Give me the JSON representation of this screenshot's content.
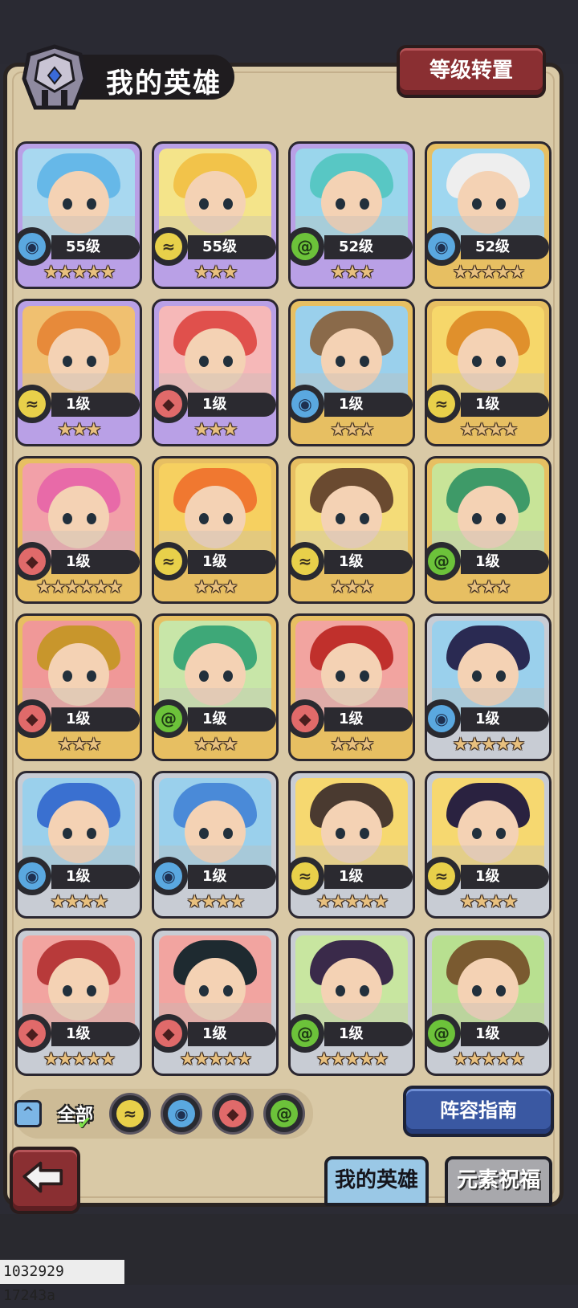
{
  "header": {
    "title": "我的英雄",
    "level_transfer_button": "等级转置"
  },
  "colors": {
    "panel_bg": "#d9c9a6",
    "card_purple": "#b9a0e6",
    "card_gold": "#e7bf62",
    "card_silver": "#c8ccd4",
    "element_water": "#5aa8e0",
    "element_earth": "#e8d04a",
    "element_wind": "#6cc23a",
    "element_fire": "#e06a6a"
  },
  "heroes": [
    {
      "level": "55级",
      "element": "water",
      "stars": "★★★★★",
      "rarity": "purple",
      "hair": "#66b8e8",
      "bg": "#a8d8f0"
    },
    {
      "level": "55级",
      "element": "earth",
      "stars": "★★★",
      "rarity": "purple",
      "hair": "#f2c34a",
      "bg": "#f4e48a"
    },
    {
      "level": "52级",
      "element": "wind",
      "stars": "★★★",
      "rarity": "purple",
      "hair": "#58c7c4",
      "bg": "#9ad6ec"
    },
    {
      "level": "52级",
      "element": "water",
      "stars": "★★★★★",
      "rarity": "gold",
      "hair": "#eeeeee",
      "bg": "#9fd7f0"
    },
    {
      "level": "1级",
      "element": "earth",
      "stars": "★★★",
      "rarity": "purple",
      "hair": "#e78a3a",
      "bg": "#f0c070"
    },
    {
      "level": "1级",
      "element": "fire",
      "stars": "★★★",
      "rarity": "purple",
      "hair": "#e0504c",
      "bg": "#f6b8b8"
    },
    {
      "level": "1级",
      "element": "water",
      "stars": "★★★",
      "rarity": "gold",
      "hair": "#8a6a4a",
      "bg": "#9ad0ec"
    },
    {
      "level": "1级",
      "element": "earth",
      "stars": "★★★★",
      "rarity": "gold",
      "hair": "#e0902c",
      "bg": "#f6d76a"
    },
    {
      "level": "1级",
      "element": "fire",
      "stars": "★★★★★★",
      "rarity": "gold",
      "hair": "#e86aa8",
      "bg": "#f2a0a8"
    },
    {
      "level": "1级",
      "element": "earth",
      "stars": "★★★",
      "rarity": "gold",
      "hair": "#f07830",
      "bg": "#f6d060"
    },
    {
      "level": "1级",
      "element": "earth",
      "stars": "★★★",
      "rarity": "gold",
      "hair": "#6a4a30",
      "bg": "#f4dc78"
    },
    {
      "level": "1级",
      "element": "wind",
      "stars": "★★★",
      "rarity": "gold",
      "hair": "#3e9a68",
      "bg": "#c8e498"
    },
    {
      "level": "1级",
      "element": "fire",
      "stars": "★★★",
      "rarity": "gold",
      "hair": "#c8962c",
      "bg": "#f09898"
    },
    {
      "level": "1级",
      "element": "wind",
      "stars": "★★★",
      "rarity": "gold",
      "hair": "#3ea878",
      "bg": "#c8e6a8"
    },
    {
      "level": "1级",
      "element": "fire",
      "stars": "★★★",
      "rarity": "gold",
      "hair": "#c0302c",
      "bg": "#f2a4a0"
    },
    {
      "level": "1级",
      "element": "water",
      "stars": "★★★★★",
      "rarity": "silver",
      "hair": "#2a2a52",
      "bg": "#9ad0ec"
    },
    {
      "level": "1级",
      "element": "water",
      "stars": "★★★★",
      "rarity": "silver",
      "hair": "#3a70d0",
      "bg": "#9ad0ec"
    },
    {
      "level": "1级",
      "element": "water",
      "stars": "★★★★",
      "rarity": "silver",
      "hair": "#4a8ad8",
      "bg": "#9ad0ec"
    },
    {
      "level": "1级",
      "element": "earth",
      "stars": "★★★★★",
      "rarity": "silver",
      "hair": "#4a3a30",
      "bg": "#f6d870"
    },
    {
      "level": "1级",
      "element": "earth",
      "stars": "★★★★",
      "rarity": "silver",
      "hair": "#2a2240",
      "bg": "#f6d870"
    },
    {
      "level": "1级",
      "element": "fire",
      "stars": "★★★★★",
      "rarity": "silver",
      "hair": "#b83a3a",
      "bg": "#f2a4a0"
    },
    {
      "level": "1级",
      "element": "fire",
      "stars": "★★★★★",
      "rarity": "silver",
      "hair": "#1e2a30",
      "bg": "#f2a4a0"
    },
    {
      "level": "1级",
      "element": "wind",
      "stars": "★★★★★",
      "rarity": "silver",
      "hair": "#3a2a4a",
      "bg": "#c8e6a0"
    },
    {
      "level": "1级",
      "element": "wind",
      "stars": "★★★★★",
      "rarity": "silver",
      "hair": "#7a5a30",
      "bg": "#b8e090"
    }
  ],
  "filters": {
    "collapse_icon": "chevron-up-icon",
    "all_label": "全部",
    "elements": [
      "earth",
      "water",
      "fire",
      "wind"
    ]
  },
  "lineup_guide_button": "阵容指南",
  "tabs": {
    "my_heroes": "我的英雄",
    "element_blessing": "元素祝福"
  },
  "back_button_icon": "back-arrow-icon",
  "debug_text": "1032929 17243a"
}
